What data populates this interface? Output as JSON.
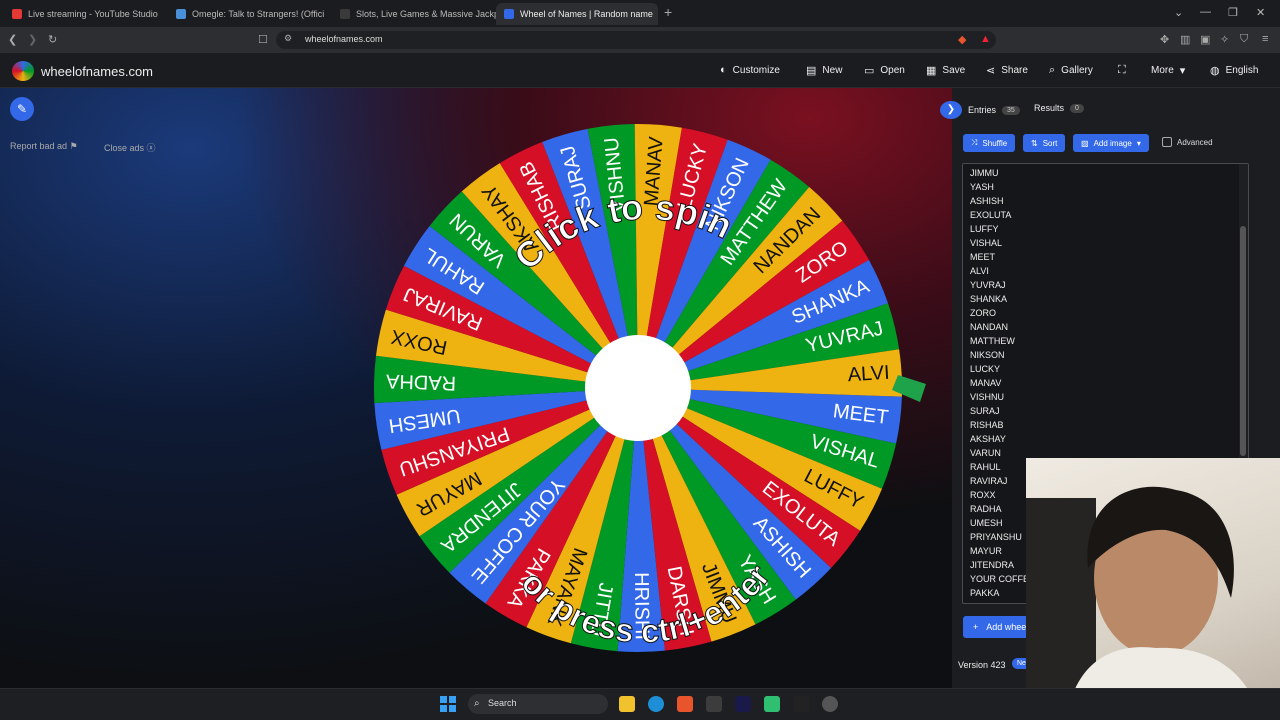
{
  "browser": {
    "tabs": [
      {
        "title": "Live streaming - YouTube Studio",
        "favicon_color": "#e53935"
      },
      {
        "title": "Omegle: Talk to Strangers! (Offici",
        "favicon_color": "#4a90d9"
      },
      {
        "title": "Slots, Live Games & Massive Jackpots",
        "favicon_color": "#3a3a3a"
      },
      {
        "title": "Wheel of Names | Random name",
        "favicon_color": "#3369e8"
      }
    ],
    "url": "wheelofnames.com"
  },
  "site": {
    "name": "wheelofnames.com",
    "nav": {
      "customize": "Customize",
      "new": "New",
      "open": "Open",
      "save": "Save",
      "share": "Share",
      "gallery": "Gallery",
      "more": "More",
      "language": "English"
    }
  },
  "left": {
    "report_ad": "Report bad ad",
    "close_ads": "Close ads"
  },
  "wheel": {
    "top_text": "Click to spin",
    "bottom_text": "or press ctrl+enter",
    "colors": [
      "#3369e8",
      "#009925",
      "#eeb211",
      "#d50f25"
    ],
    "pointer_color": "#1fa34a",
    "slices_clockwise_from_right": [
      "MEET",
      "VISHAL",
      "LUFFY",
      "EXOLUTA",
      "ASHISH",
      "YASH",
      "JIMMU",
      "DARSH",
      "HRISHI",
      "JITTU",
      "MAYANK",
      "PAKKA",
      "YOUR COFFE",
      "JITENDRA",
      "MAYUR",
      "PRIYANSHU",
      "UMESH",
      "RADHA",
      "ROXX",
      "RAVIRAJ",
      "RAHUL",
      "VARUN",
      "AKSHAY",
      "RISHAB",
      "SURAJ",
      "VISHNU",
      "MANAV",
      "LUCKY",
      "NIKSON",
      "MATTHEW",
      "NANDAN",
      "ZORO",
      "SHANKA",
      "YUVRAJ",
      "ALVI"
    ]
  },
  "panel": {
    "entries_label": "Entries",
    "entries_count": "35",
    "results_label": "Results",
    "results_count": "0",
    "shuffle": "Shuffle",
    "sort": "Sort",
    "add_image": "Add image",
    "advanced": "Advanced",
    "entries": [
      "JIMMU",
      "YASH",
      "ASHISH",
      "EXOLUTA",
      "LUFFY",
      "VISHAL",
      "MEET",
      "ALVI",
      "YUVRAJ",
      "SHANKA",
      "ZORO",
      "NANDAN",
      "MATTHEW",
      "NIKSON",
      "LUCKY",
      "MANAV",
      "VISHNU",
      "SURAJ",
      "RISHAB",
      "AKSHAY",
      "VARUN",
      "RAHUL",
      "RAVIRAJ",
      "ROXX",
      "RADHA",
      "UMESH",
      "PRIYANSHU",
      "MAYUR",
      "JITENDRA",
      "YOUR COFFE",
      "PAKKA"
    ],
    "add_wheel": "Add whee",
    "version": "Version 423",
    "new_badge": "New"
  },
  "taskbar": {
    "search": "Search"
  }
}
